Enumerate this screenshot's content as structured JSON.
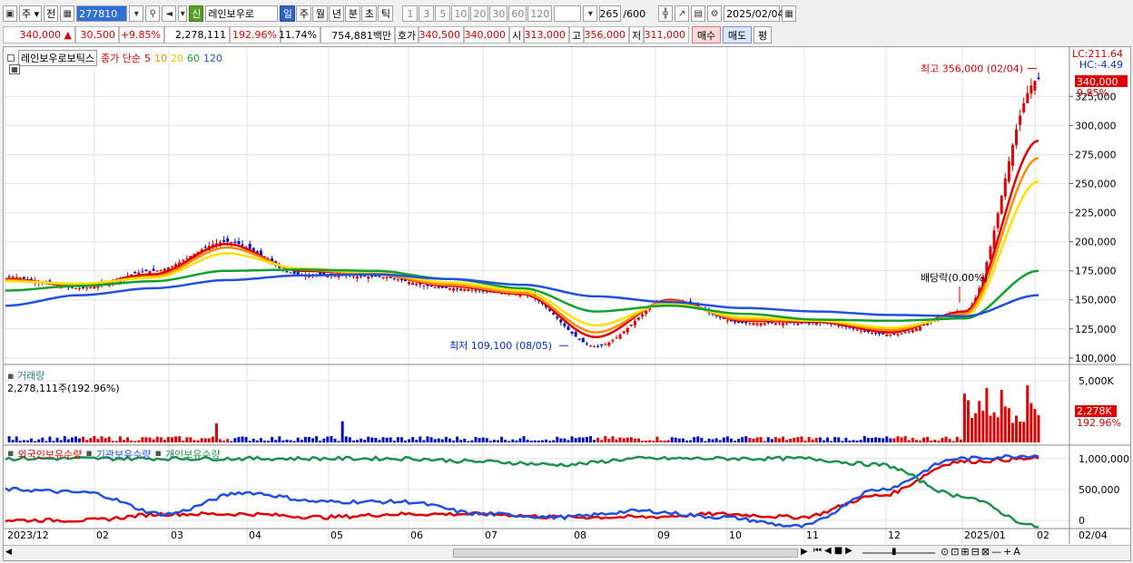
{
  "toolbar": {
    "period_tab": "주",
    "prev_button": "전",
    "code_value": "277810",
    "credit_badge": "신",
    "stock_name": "레인보우로",
    "timeframes": [
      "일",
      "주",
      "월",
      "년",
      "분",
      "초",
      "틱"
    ],
    "active_timeframe": "일",
    "intervals": [
      "1",
      "3",
      "5",
      "10",
      "20",
      "30",
      "60",
      "120"
    ],
    "count_value": "265",
    "count_max": "/600",
    "date_value": "2025/02/04"
  },
  "quote": {
    "price": "340,000",
    "change": "30,500",
    "change_pct": "+9.85%",
    "volume": "2,278,111",
    "volume_ratio": "192.96%",
    "turnover": "11.74%",
    "amount": "754,881백만",
    "hoga_label": "호가",
    "ask": "340,500",
    "bid": "340,000",
    "open_label": "시",
    "open": "313,000",
    "high_label": "고",
    "high": "356,000",
    "low_label": "저",
    "low": "311,000",
    "buy_button": "매수",
    "sell_button": "매도",
    "extra_button": "평"
  },
  "legend": {
    "stock": "레인보우로보틱스",
    "ma_label": "종가 단순",
    "ma5": "5",
    "ma10": "10",
    "ma20": "20",
    "ma60": "60",
    "ma120": "120",
    "lc": "LC:211.64",
    "hc": "HC:-4.49"
  },
  "annotations": {
    "high": "최고 356,000 (02/04)",
    "low": "최저 109,100 (08/05)",
    "dividend": "배당락(0.00%)",
    "price_tag": "340,000",
    "pct_tag": "9.85%"
  },
  "volume_panel": {
    "title": "거래량",
    "current": "2,278,111주(192.96%)",
    "tag": "2,278K",
    "tag_pct": "192.96%"
  },
  "holders_panel": {
    "foreign": "외국인보유수량",
    "institution": "기관보유수량",
    "individual": "개인보유수량"
  },
  "colors": {
    "up": "#e00000",
    "down": "#0010c0",
    "ma5": "#e00000",
    "ma10": "#ff8c00",
    "ma20": "#ffe000",
    "ma60": "#10a030",
    "ma120": "#2050e0",
    "foreign": "#e00000",
    "institution": "#2050e0",
    "individual": "#209050"
  },
  "chart_data": [
    {
      "type": "line",
      "title": "",
      "x": [
        "2023/12",
        "02",
        "03",
        "04",
        "05",
        "06",
        "07",
        "08",
        "09",
        "10",
        "11",
        "12",
        "2025/01",
        "02"
      ],
      "yticks": [
        "100,000",
        "125,000",
        "150,000",
        "175,000",
        "200,000",
        "225,000",
        "250,000",
        "275,000",
        "300,000",
        "325,000"
      ],
      "ylim": [
        96000,
        358000
      ],
      "series": [
        {
          "name": "종가",
          "values": [
            170000,
            160000,
            175000,
            200000,
            172000,
            170000,
            160000,
            155000,
            110000,
            150000,
            130000,
            130000,
            120000,
            140000,
            340000
          ]
        },
        {
          "name": "5",
          "values": [
            168000,
            162000,
            172000,
            198000,
            175000,
            172000,
            162000,
            155000,
            118000,
            150000,
            132000,
            131000,
            122000,
            140000,
            287000
          ]
        },
        {
          "name": "10",
          "values": [
            167000,
            163000,
            170000,
            195000,
            176000,
            172000,
            163000,
            156000,
            122000,
            149000,
            133000,
            132000,
            124000,
            138000,
            272000
          ]
        },
        {
          "name": "20",
          "values": [
            166000,
            164000,
            169000,
            190000,
            177000,
            173000,
            165000,
            158000,
            128000,
            147000,
            135000,
            132000,
            126000,
            136000,
            252000
          ]
        },
        {
          "name": "60",
          "values": [
            158000,
            162000,
            166000,
            175000,
            176000,
            175000,
            168000,
            160000,
            140000,
            145000,
            138000,
            133000,
            132000,
            134000,
            175000
          ]
        },
        {
          "name": "120",
          "values": [
            145000,
            154000,
            160000,
            167000,
            171000,
            172000,
            168000,
            163000,
            153000,
            148000,
            143000,
            140000,
            137000,
            136000,
            154000
          ]
        }
      ],
      "high": 356000,
      "low": 109100
    },
    {
      "type": "bar",
      "title": "거래량",
      "yticks": [
        "5,000K"
      ],
      "latest": 2278111
    },
    {
      "type": "line",
      "title": "보유수량",
      "yticks": [
        "1,000,000",
        "500,000",
        "0"
      ],
      "series": [
        {
          "name": "외국인보유수량",
          "values": [
            0,
            0,
            100000,
            100000,
            50000,
            100000,
            100000,
            50000,
            50000,
            100000,
            50000,
            400000,
            950000,
            1000000
          ]
        },
        {
          "name": "기관보유수량",
          "values": [
            500000,
            450000,
            100000,
            450000,
            300000,
            300000,
            100000,
            50000,
            150000,
            50000,
            -100000,
            500000,
            1000000,
            1050000
          ]
        },
        {
          "name": "개인보유수량",
          "values": [
            1000000,
            1000000,
            1000000,
            1000000,
            1000000,
            1000000,
            950000,
            900000,
            1000000,
            1000000,
            1000000,
            900000,
            400000,
            -100000
          ]
        }
      ]
    }
  ],
  "xaxis_labels": [
    "2023/12",
    "02",
    "03",
    "04",
    "05",
    "06",
    "07",
    "08",
    "09",
    "10",
    "11",
    "12",
    "2025/01",
    "02",
    "02/04"
  ]
}
